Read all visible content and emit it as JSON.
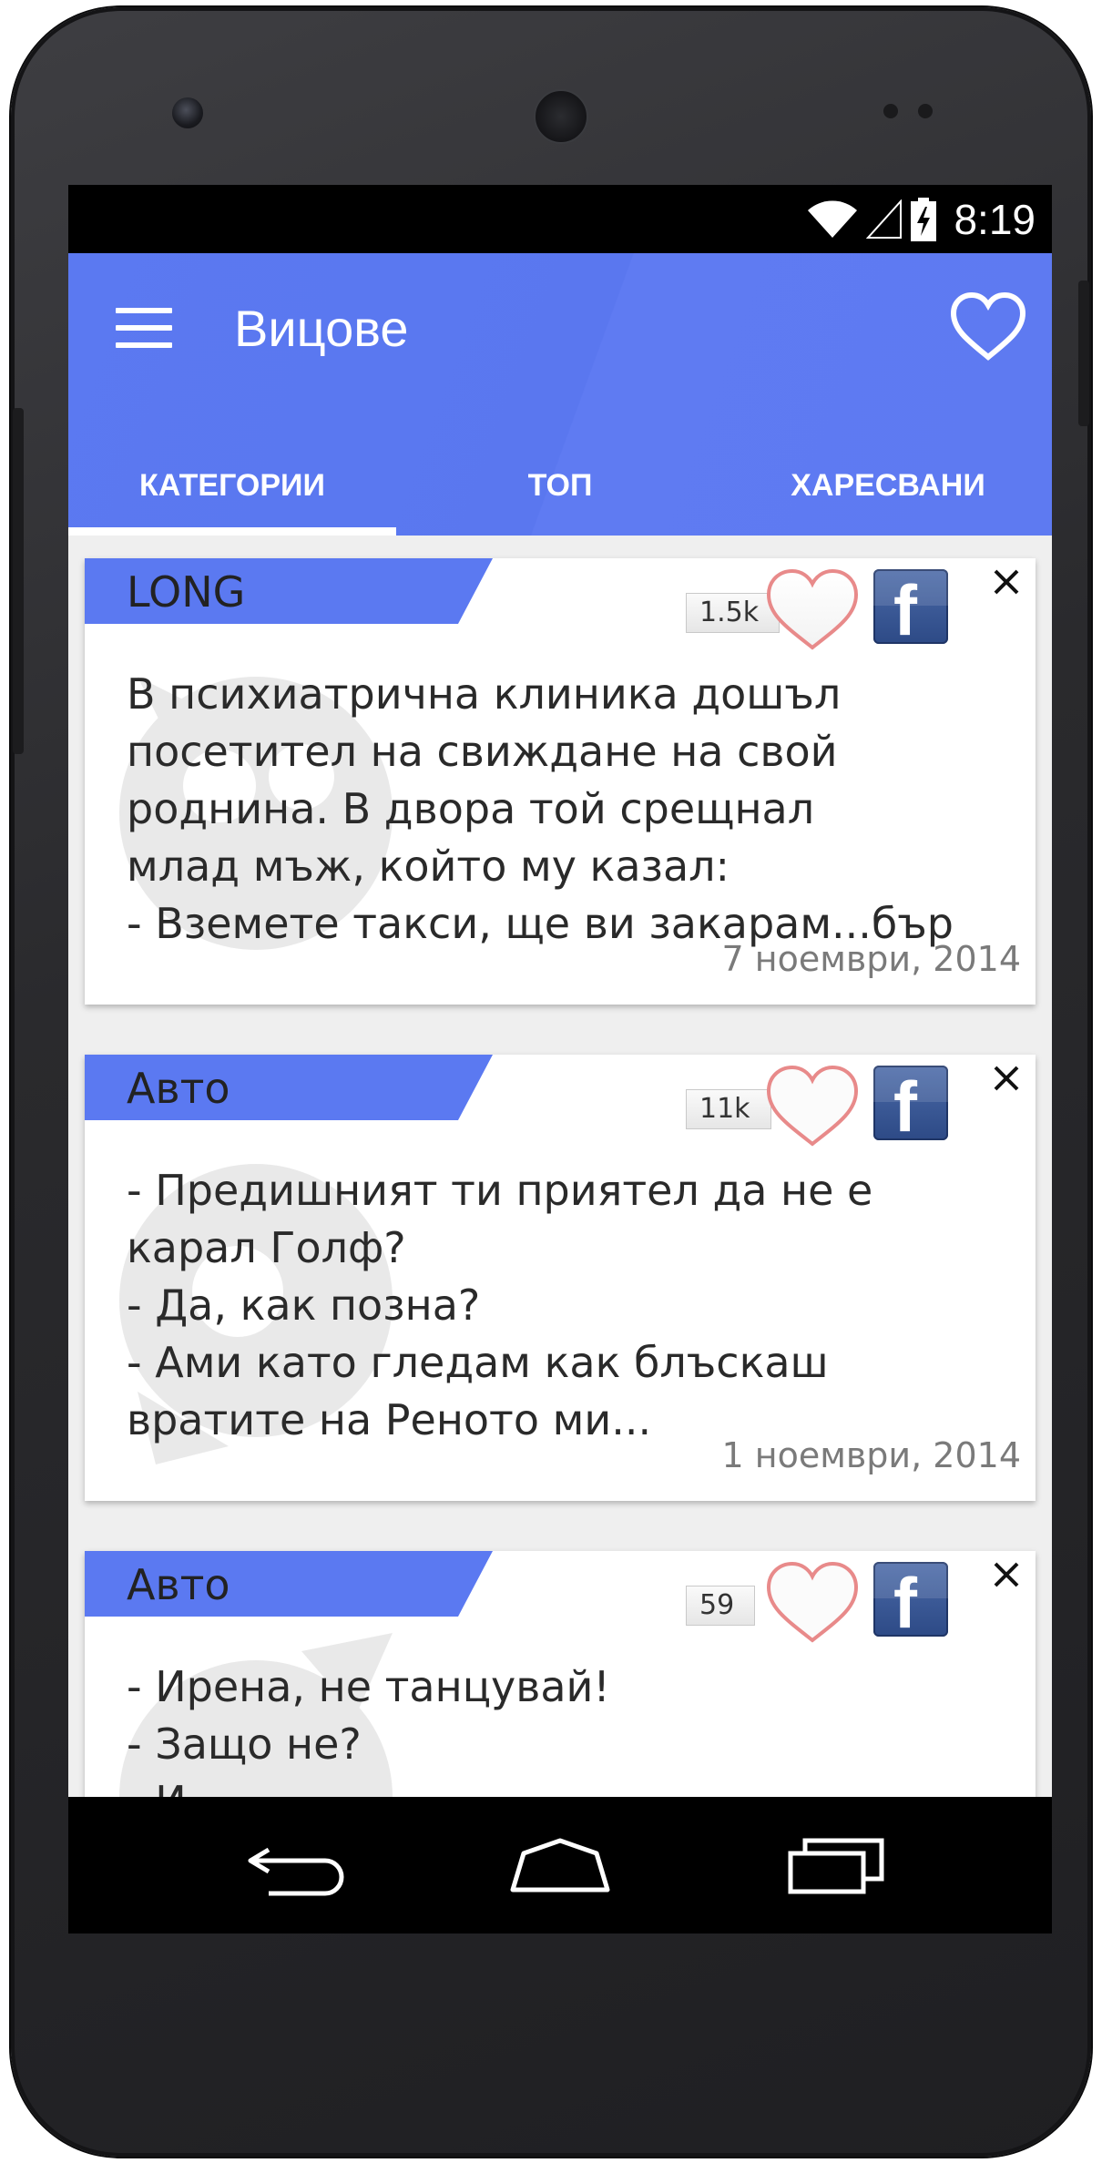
{
  "status_bar": {
    "time": "8:19"
  },
  "app_bar": {
    "title": "Вицове"
  },
  "tabs": [
    {
      "label": "КАТЕГОРИИ",
      "selected": true
    },
    {
      "label": "ТОП",
      "selected": false
    },
    {
      "label": "ХАРЕСВАНИ",
      "selected": false
    }
  ],
  "jokes": [
    {
      "category": "LONG",
      "likes": "1.5k",
      "text": "В психиатрична клиника дошъл\nпосетител на свиждане на свой\nроднина. В двора той срещнал\nмлад мъж, който му казал:\n- Вземете такси, ще ви закарам...бър",
      "date": "7 ноември, 2014"
    },
    {
      "category": "Авто",
      "likes": "11k",
      "text": "- Предишният ти приятел да не е\nкарал Голф?\n- Да, как позна?\n- Ами като гледам как блъскаш\nвратите на Реното ми...",
      "date": "1 ноември, 2014"
    },
    {
      "category": "Авто",
      "likes": "59",
      "text": "- Ирена, не танцувай!\n- Защо не?\n- И",
      "date": ""
    }
  ],
  "colors": {
    "accent": "#5b79f1",
    "facebook": "#3b5998"
  }
}
